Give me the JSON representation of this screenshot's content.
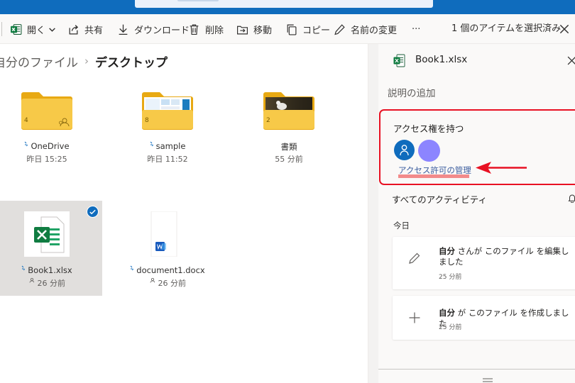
{
  "toolbar": {
    "open": "開く",
    "share": "共有",
    "download": "ダウンロード",
    "delete": "削除",
    "move": "移動",
    "copy": "コピー",
    "rename": "名前の変更",
    "more": "···",
    "selection_count": "1 個のアイテムを選択済み"
  },
  "breadcrumb": {
    "parent": "自分のファイル",
    "separator": "›",
    "current": "デスクトップ"
  },
  "files": [
    {
      "name": "OneDrive",
      "meta": "昨日 15:25",
      "count": "4",
      "icon": "folder-shared-icon"
    },
    {
      "name": "sample",
      "meta": "昨日 11:52",
      "count": "8",
      "icon": "folder-thumbnail-icon"
    },
    {
      "name": "書類",
      "meta": "55 分前",
      "count": "2",
      "icon": "folder-photo-icon"
    },
    {
      "name": "Book1.xlsx",
      "meta": "26 分前",
      "icon": "excel-file-icon",
      "selected": true
    },
    {
      "name": "document1.docx",
      "meta": "26 分前",
      "icon": "word-file-icon"
    }
  ],
  "panel": {
    "title": "Book1.xlsx",
    "add_description": "説明の追加",
    "access_title": "アクセス権を持つ",
    "manage_access": "アクセス許可の管理",
    "activity_title": "すべてのアクティビティ",
    "today": "今日",
    "activities": [
      {
        "user": "自分",
        "text1": " さんが ",
        "target": "このファイル",
        "text2": " を編集しました",
        "time": "25 分前",
        "icon": "pencil-icon"
      },
      {
        "user": "自分",
        "text1": " が ",
        "target": "このファイル",
        "text2": " を作成しました",
        "time": "25 分前",
        "icon": "plus-icon"
      }
    ]
  },
  "colors": {
    "brand": "#0f6cbd",
    "highlight_box": "#e81123",
    "folder": "#f7c948",
    "avatar_secondary": "#8c85ff"
  }
}
